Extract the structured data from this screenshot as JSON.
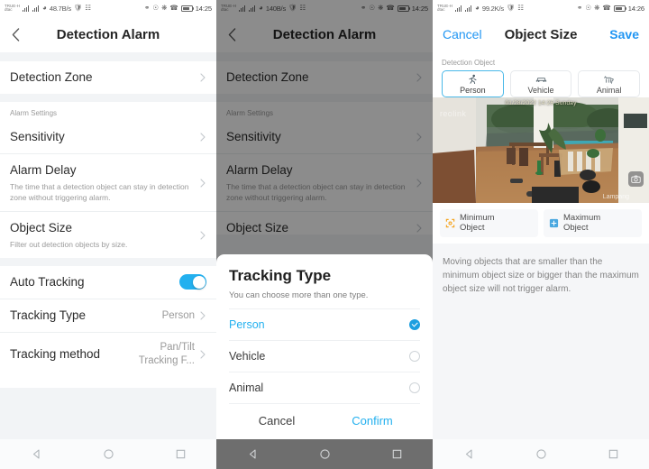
{
  "panels": [
    {
      "id": "detection-alarm",
      "statusbar": {
        "carrier_line1": "TRUE-H",
        "carrier_line2": "dtac",
        "netspeed": "48.7B/s",
        "time": "14:25"
      },
      "header": {
        "title": "Detection Alarm",
        "back_icon": "chevron-left-icon"
      },
      "rows": [
        {
          "title": "Detection Zone",
          "sub": "",
          "value": "",
          "chevron": true
        },
        {
          "title": "Sensitivity",
          "sub": "",
          "value": "",
          "chevron": true
        },
        {
          "title": "Alarm Delay",
          "sub": "The time that a detection object can stay in detection zone without triggering alarm.",
          "value": "",
          "chevron": true
        },
        {
          "title": "Object Size",
          "sub": "Filter out detection objects by size.",
          "value": "",
          "chevron": true
        },
        {
          "title": "Auto Tracking",
          "sub": "",
          "value": "",
          "chevron": false,
          "toggle": true,
          "toggle_on": true
        },
        {
          "title": "Tracking Type",
          "sub": "",
          "value": "Person",
          "chevron": true
        },
        {
          "title": "Tracking method",
          "sub": "",
          "value": "Pan/Tilt\nTracking F...",
          "chevron": true
        }
      ],
      "section_label": "Alarm Settings"
    },
    {
      "id": "tracking-type-sheet",
      "statusbar": {
        "carrier_line1": "TRUE-H",
        "carrier_line2": "dtac",
        "netspeed": "140B/s",
        "time": "14:25"
      },
      "header": {
        "title": "Detection Alarm",
        "back_icon": "chevron-left-icon"
      },
      "rows": [
        {
          "title": "Detection Zone",
          "sub": "",
          "value": "",
          "chevron": true
        },
        {
          "title": "Sensitivity",
          "sub": "",
          "value": "",
          "chevron": true
        },
        {
          "title": "Alarm Delay",
          "sub": "The time that a detection object can stay in detection zone without triggering alarm.",
          "value": "",
          "chevron": true
        },
        {
          "title": "Object Size",
          "sub": "",
          "value": "",
          "chevron": true
        }
      ],
      "section_label": "Alarm Settings",
      "sheet": {
        "title": "Tracking Type",
        "subtitle": "You can choose more than one type.",
        "options": [
          {
            "label": "Person",
            "selected": true
          },
          {
            "label": "Vehicle",
            "selected": false
          },
          {
            "label": "Animal",
            "selected": false
          }
        ],
        "cancel_label": "Cancel",
        "confirm_label": "Confirm"
      }
    },
    {
      "id": "object-size",
      "statusbar": {
        "carrier_line1": "TRUE-H",
        "carrier_line2": "dtac",
        "netspeed": "99.2K/s",
        "time": "14:26"
      },
      "header": {
        "cancel_label": "Cancel",
        "title": "Object Size",
        "save_label": "Save"
      },
      "detection_object_label": "Detection Object",
      "object_cards": [
        {
          "label": "Person",
          "icon": "person-running-icon",
          "active": true
        },
        {
          "label": "Vehicle",
          "icon": "car-icon",
          "active": false
        },
        {
          "label": "Animal",
          "icon": "dog-icon",
          "active": false
        }
      ],
      "camera": {
        "timestamp": "01/28/2022 14:26 Sunday",
        "brand": "reolink",
        "place_label": "Lampang",
        "badge_icon": "camera-icon"
      },
      "size_tabs": [
        {
          "label_line1": "Minimum",
          "label_line2": "Object",
          "icon": "min-box-icon",
          "color": "#f5a623"
        },
        {
          "label_line1": "Maximum",
          "label_line2": "Object",
          "icon": "max-box-icon",
          "color": "#4aa8e0"
        }
      ],
      "note": "Moving objects that are smaller than the minimum object size or bigger than the maximum object size will not trigger alarm."
    }
  ],
  "android_nav": {
    "back": "back-triangle-icon",
    "home": "home-circle-icon",
    "recents": "recents-square-icon"
  },
  "colors": {
    "accent": "#23b0ef",
    "dim": "rgba(0,0,0,0.45)",
    "min_object": "#f5a623",
    "max_object": "#4aa8e0"
  }
}
